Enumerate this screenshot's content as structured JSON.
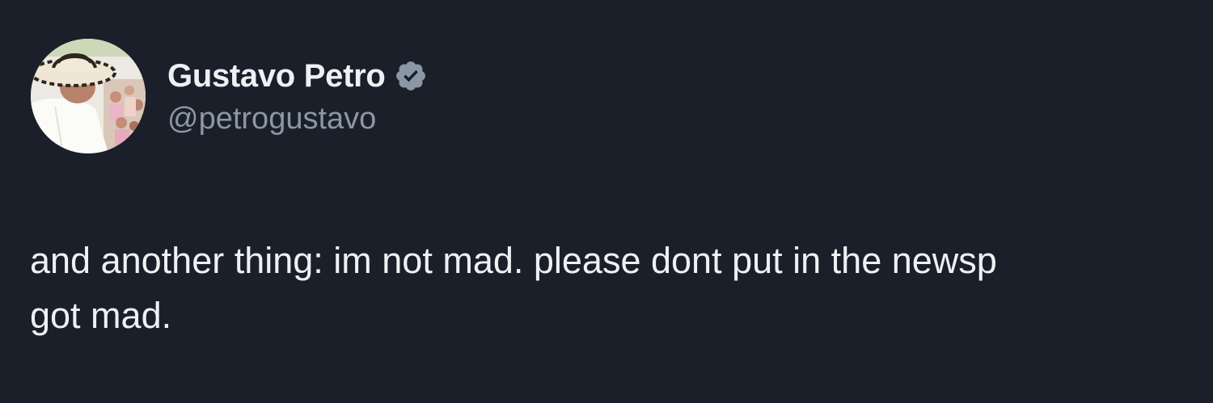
{
  "tweet": {
    "author": {
      "display_name": "Gustavo Petro",
      "handle": "@petrogustavo",
      "verified": true,
      "verified_icon": "verified-badge-icon",
      "badge_color": "#8b97a5"
    },
    "text_line_1": "and another thing: im not mad. please dont put in the newsp",
    "text_line_2": "got mad."
  },
  "colors": {
    "background": "#1b1f29",
    "primary_text": "#eef1f4",
    "secondary_text": "#8b97a5"
  }
}
